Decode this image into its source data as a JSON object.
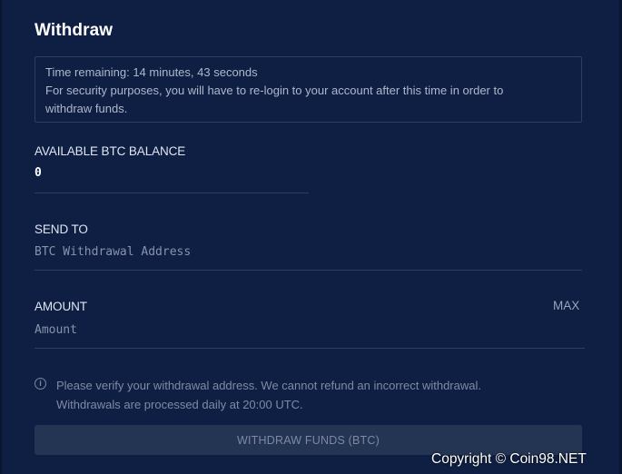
{
  "form": {
    "title": "Withdraw",
    "notice": {
      "line1": "Time remaining: 14 minutes, 43 seconds",
      "line2": "For security purposes, you will have to re-login to your account after this time in order to",
      "line3": "withdraw funds."
    },
    "balance": {
      "label": "AVAILABLE BTC BALANCE",
      "value": "0"
    },
    "send_to": {
      "label": "SEND TO",
      "placeholder": "BTC Withdrawal Address",
      "value": ""
    },
    "amount": {
      "label": "AMOUNT",
      "max_label": "MAX",
      "placeholder": "Amount",
      "value": ""
    },
    "info": {
      "icon": "info-icon",
      "line1": "Please verify your withdrawal address. We cannot refund an incorrect withdrawal.",
      "line2": "Withdrawals are processed daily at 20:00 UTC."
    },
    "submit_label": "WITHDRAW FUNDS (BTC)"
  },
  "watermark": "Copyright © Coin98.NET",
  "colors": {
    "background": "#0f1f43",
    "border": "#2d3d63",
    "button": "#243453",
    "title": "#ffffff"
  }
}
